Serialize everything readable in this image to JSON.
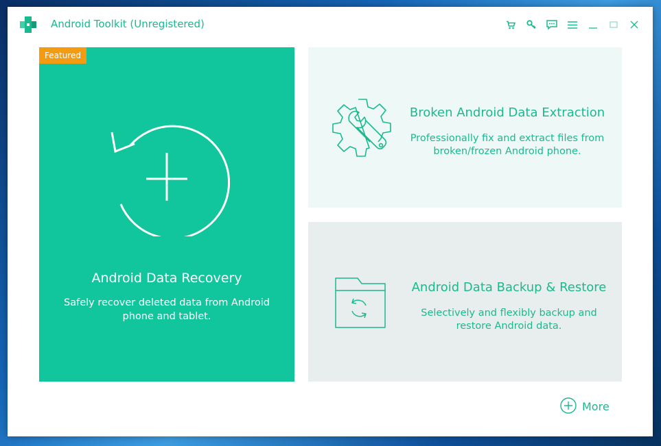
{
  "window": {
    "title": "Android Toolkit (Unregistered)",
    "accent_color": "#1bb98e",
    "controls": [
      "cart-icon",
      "key-icon",
      "feedback-icon",
      "menu-icon",
      "minimize-icon",
      "maximize-icon",
      "close-icon"
    ]
  },
  "cards": {
    "recovery": {
      "badge": "Featured",
      "title": "Android Data Recovery",
      "description": "Safely recover deleted data from Android phone and tablet.",
      "icon": "circular-arrow-plus-icon",
      "color": "#11c69d"
    },
    "broken": {
      "title": "Broken Android Data Extraction",
      "description": "Professionally fix and extract files from broken/frozen Android phone.",
      "icon": "gear-wrench-icon"
    },
    "backup": {
      "title": "Android Data Backup & Restore",
      "description": "Selectively and flexibly backup and restore Android data.",
      "icon": "folder-sync-icon"
    }
  },
  "more": {
    "label": "More",
    "icon": "plus-circle-icon"
  }
}
